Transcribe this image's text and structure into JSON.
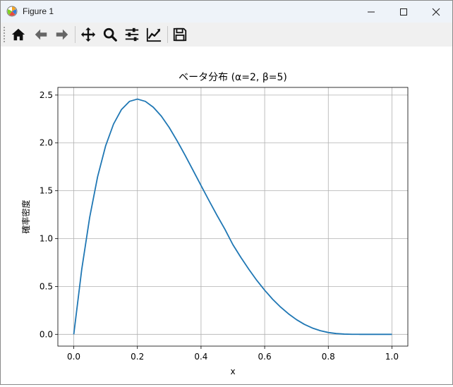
{
  "window": {
    "title": "Figure 1"
  },
  "toolbar": {
    "buttons": [
      {
        "name": "home-icon"
      },
      {
        "name": "back-icon"
      },
      {
        "name": "forward-icon"
      },
      {
        "name": "pan-icon"
      },
      {
        "name": "zoom-icon"
      },
      {
        "name": "subplots-icon"
      },
      {
        "name": "edit-axis-icon"
      },
      {
        "name": "save-icon"
      }
    ]
  },
  "colors": {
    "line": "#1f77b4",
    "grid": "#b0b0b0",
    "titlebar": "#eef3f9",
    "toolbar": "#f0f0f0"
  },
  "chart_data": {
    "type": "line",
    "title": "ベータ分布 (α=2, β=5)",
    "xlabel": "x",
    "ylabel": "確率密度",
    "xlim": [
      -0.05,
      1.05
    ],
    "ylim": [
      -0.123,
      2.58
    ],
    "grid": true,
    "xticks": [
      0.0,
      0.2,
      0.4,
      0.6,
      0.8,
      1.0
    ],
    "xtick_labels": [
      "0.0",
      "0.2",
      "0.4",
      "0.6",
      "0.8",
      "1.0"
    ],
    "yticks": [
      0.0,
      0.5,
      1.0,
      1.5,
      2.0,
      2.5
    ],
    "ytick_labels": [
      "0.0",
      "0.5",
      "1.0",
      "1.5",
      "2.0",
      "2.5"
    ],
    "series": [
      {
        "x": [
          0.0,
          0.025,
          0.05,
          0.075,
          0.1,
          0.125,
          0.15,
          0.175,
          0.2,
          0.225,
          0.25,
          0.275,
          0.3,
          0.325,
          0.35,
          0.375,
          0.4,
          0.425,
          0.45,
          0.475,
          0.5,
          0.525,
          0.55,
          0.575,
          0.6,
          0.625,
          0.65,
          0.675,
          0.7,
          0.725,
          0.75,
          0.775,
          0.8,
          0.825,
          0.85,
          0.875,
          0.9,
          0.925,
          0.95,
          0.975,
          1.0
        ],
        "y": [
          0.0,
          0.678,
          1.222,
          1.648,
          1.968,
          2.197,
          2.349,
          2.434,
          2.458,
          2.434,
          2.373,
          2.281,
          2.161,
          2.021,
          1.871,
          1.713,
          1.555,
          1.398,
          1.245,
          1.098,
          0.9375,
          0.805,
          0.681,
          0.565,
          0.461,
          0.367,
          0.285,
          0.214,
          0.1535,
          0.104,
          0.0659,
          0.0381,
          0.0192,
          0.0081,
          0.0025,
          0.0004,
          6e-05,
          0.0,
          0.0,
          0.0,
          0.0
        ]
      }
    ]
  }
}
